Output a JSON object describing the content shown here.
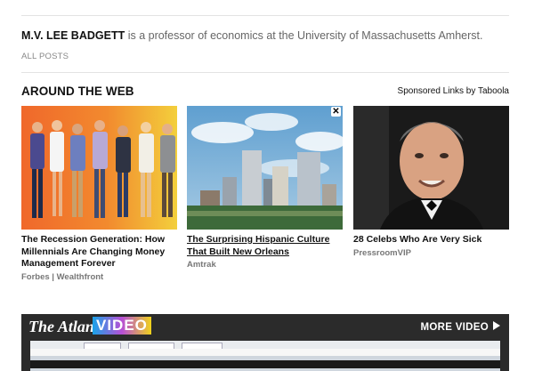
{
  "author": {
    "name": "M.V. LEE BADGETT",
    "bio": " is a professor of economics at the University of Massachusetts Amherst."
  },
  "all_posts_label": "ALL POSTS",
  "around_web": {
    "heading": "AROUND THE WEB",
    "sponsored_label": "Sponsored Links by Taboola",
    "cards": [
      {
        "title": "The Recession Generation: How Millennials Are Changing Money Management Forever",
        "source": "Forbes | Wealthfront"
      },
      {
        "title": "The Surprising Hispanic Culture That Built New Orleans",
        "source": "Amtrak"
      },
      {
        "title": "28 Celebs Who Are Very Sick",
        "source": "PressroomVIP"
      }
    ]
  },
  "video": {
    "brand": "The Atlantic",
    "label": "VIDEO",
    "more_label": "MORE VIDEO"
  }
}
